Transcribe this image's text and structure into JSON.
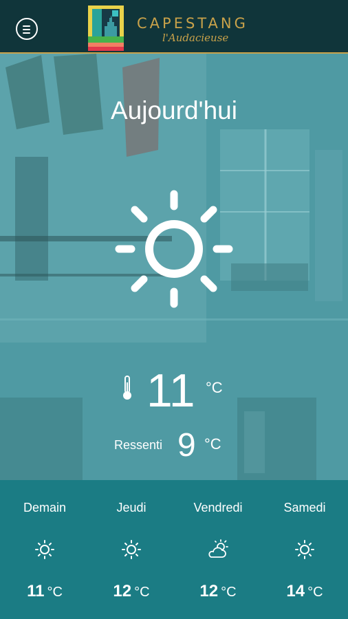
{
  "header": {
    "menu_icon": "menu-icon",
    "brand": "CAPESTANG",
    "tagline": "l'Audacieuse"
  },
  "today": {
    "title": "Aujourd'hui",
    "icon": "sun-icon",
    "temperature": "11",
    "unit": "°C",
    "feels_like_label": "Ressenti",
    "feels_like": "9",
    "feels_like_unit": "°C"
  },
  "forecast": [
    {
      "day": "Demain",
      "icon": "sun-icon",
      "temp": "11",
      "unit": "°C"
    },
    {
      "day": "Jeudi",
      "icon": "sun-icon",
      "temp": "12",
      "unit": "°C"
    },
    {
      "day": "Vendredi",
      "icon": "partly-cloudy-icon",
      "temp": "12",
      "unit": "°C"
    },
    {
      "day": "Samedi",
      "icon": "sun-icon",
      "temp": "14",
      "unit": "°C"
    }
  ],
  "colors": {
    "header_bg": "#10353a",
    "gold": "#c9a24a",
    "hero_tint": "#4b97a0",
    "forecast_bg": "#1b7c84"
  }
}
